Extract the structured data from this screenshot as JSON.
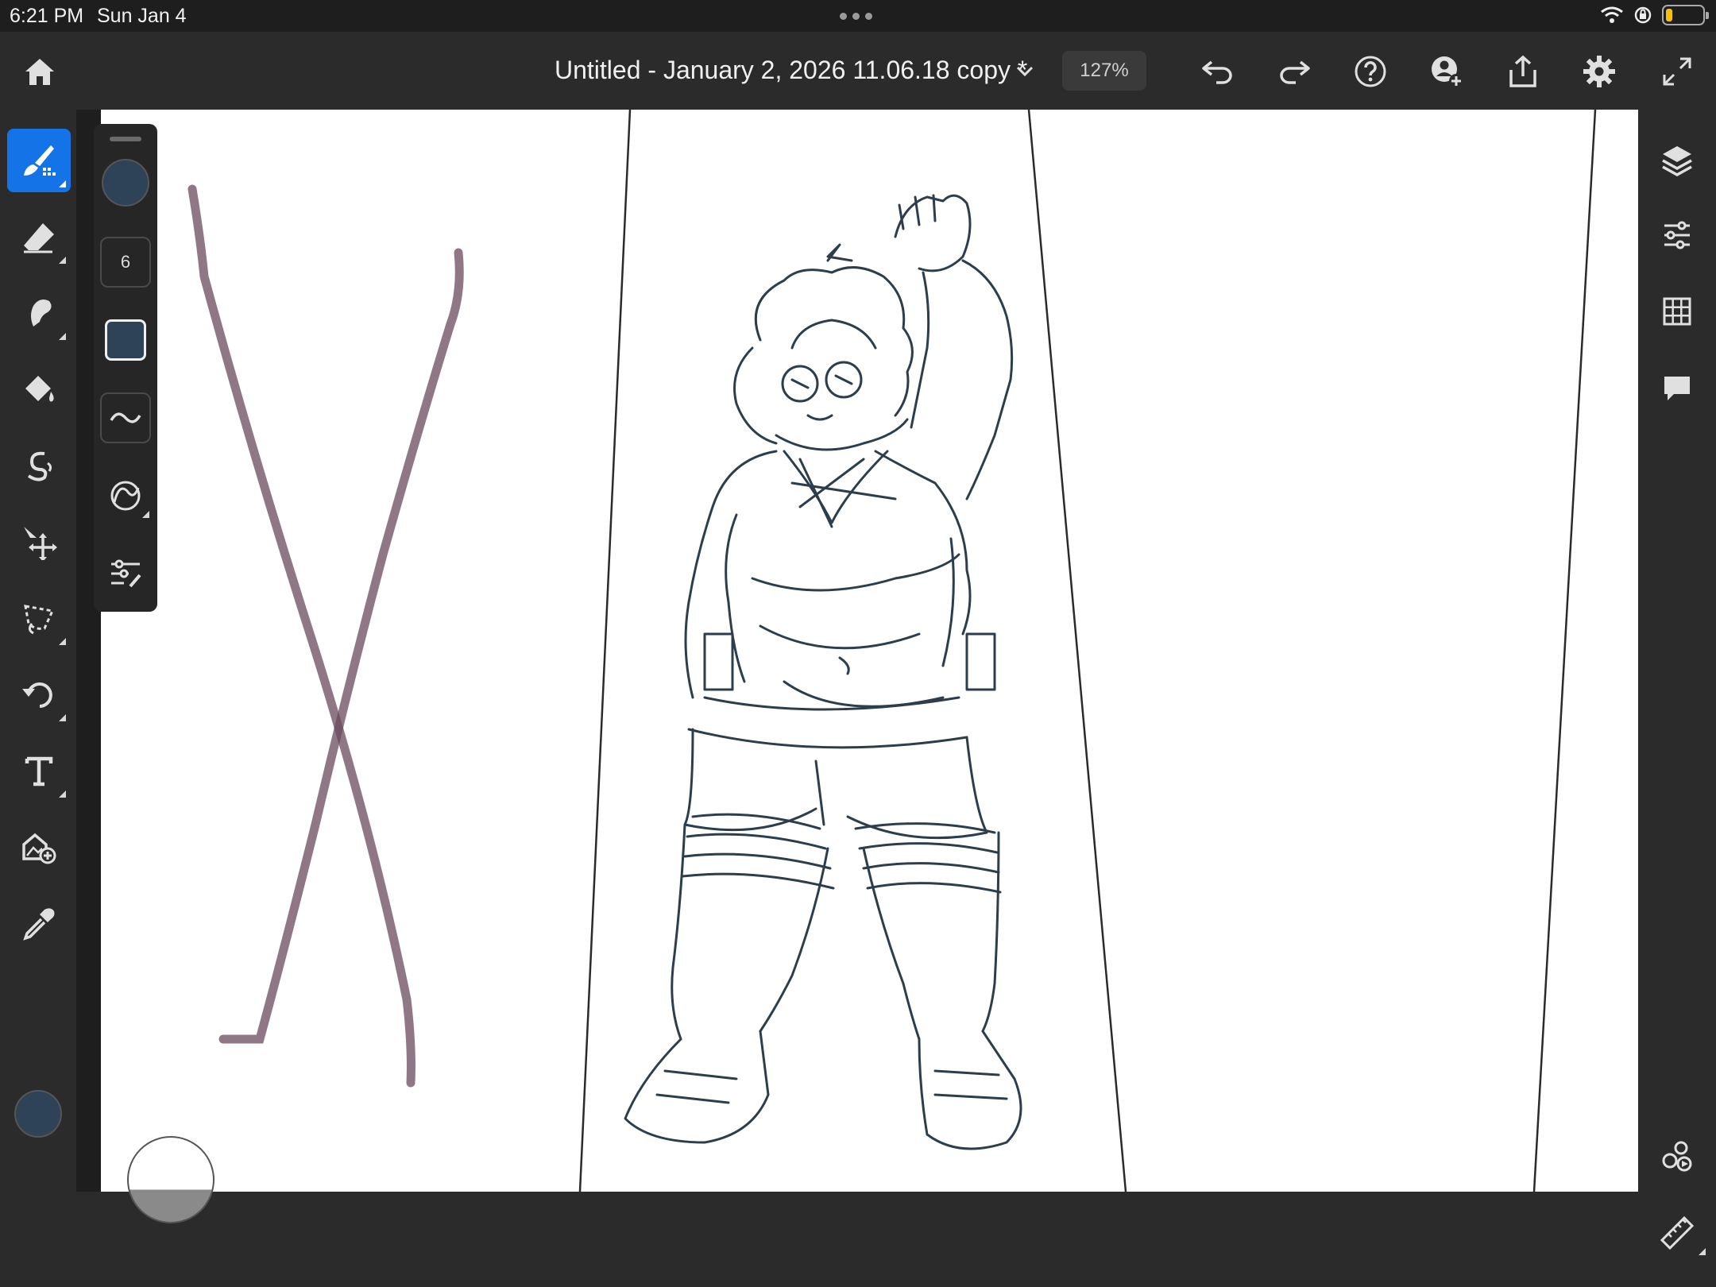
{
  "status_bar": {
    "time": "6:21 PM",
    "date": "Sun Jan 4"
  },
  "toolbar": {
    "document_title": "Untitled - January 2, 2026 11.06.18 copy *",
    "zoom": "127%",
    "icons": [
      "home-icon",
      "chevron-down-icon",
      "undo-icon",
      "redo-icon",
      "help-icon",
      "invite-icon",
      "share-icon",
      "gear-icon",
      "fullscreen-icon"
    ]
  },
  "left_tools": {
    "active_tool": "brush",
    "items": [
      "brush",
      "eraser",
      "smudge",
      "fill",
      "liquify",
      "move",
      "lasso",
      "transform",
      "text",
      "place-image",
      "eyedropper"
    ]
  },
  "brush_panel": {
    "size": "6"
  },
  "colors": {
    "current_color": "#2e4357",
    "accent": "#1473e6",
    "guide_stroke": "#6b4a5c",
    "sketch_stroke": "#2c3e4c"
  },
  "right_rail": {
    "items": [
      "layers",
      "adjustments",
      "grid",
      "comments",
      "livestream",
      "ruler"
    ]
  }
}
